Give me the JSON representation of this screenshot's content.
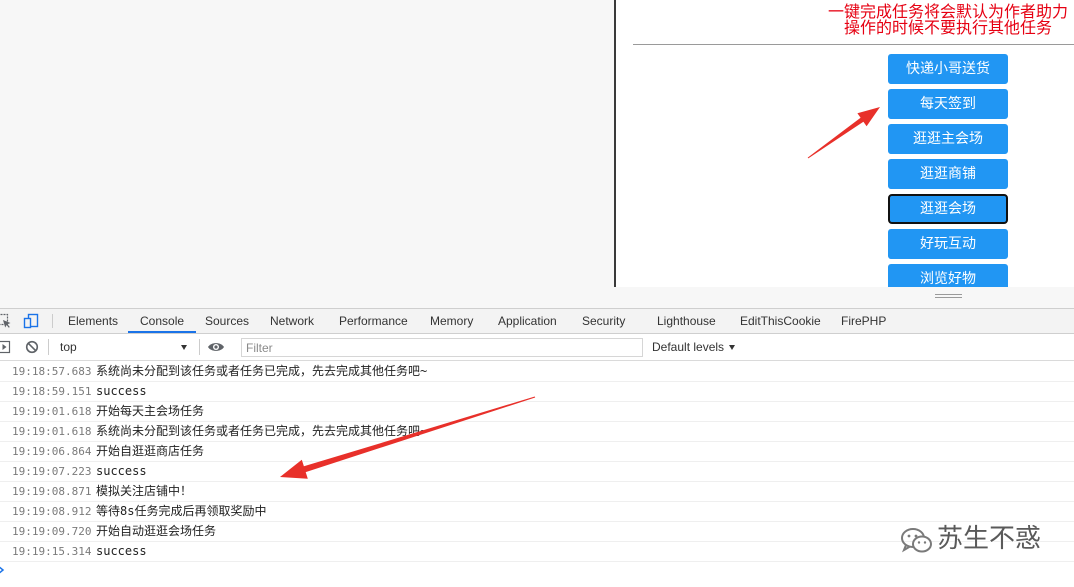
{
  "page": {
    "notice": [
      "一键完成任务将会默认为作者助力",
      "操作的时候不要执行其他任务"
    ],
    "buttons": [
      {
        "label": "快递小哥送货"
      },
      {
        "label": "每天签到"
      },
      {
        "label": "逛逛主会场"
      },
      {
        "label": "逛逛商铺"
      },
      {
        "label": "逛逛会场",
        "focused": true
      },
      {
        "label": "好玩互动"
      },
      {
        "label": "浏览好物"
      }
    ]
  },
  "devtools": {
    "tabs": [
      {
        "label": "Elements"
      },
      {
        "label": "Console",
        "active": true
      },
      {
        "label": "Sources"
      },
      {
        "label": "Network"
      },
      {
        "label": "Performance"
      },
      {
        "label": "Memory"
      },
      {
        "label": "Application"
      },
      {
        "label": "Security"
      },
      {
        "label": "Lighthouse"
      },
      {
        "label": "EditThisCookie"
      },
      {
        "label": "FirePHP"
      }
    ],
    "context": "top",
    "filter_placeholder": "Filter",
    "levels": "Default levels",
    "messages": [
      {
        "time": "19:18:57.683",
        "text": "系统尚未分配到该任务或者任务已完成，先去完成其他任务吧~"
      },
      {
        "time": "19:18:59.151",
        "text": "success"
      },
      {
        "time": "19:19:01.618",
        "text": "开始每天主会场任务"
      },
      {
        "time": "19:19:01.618",
        "text": "系统尚未分配到该任务或者任务已完成，先去完成其他任务吧~"
      },
      {
        "time": "19:19:06.864",
        "text": "开始自逛逛商店任务"
      },
      {
        "time": "19:19:07.223",
        "text": "success"
      },
      {
        "time": "19:19:08.871",
        "text": "模拟关注店铺中！"
      },
      {
        "time": "19:19:08.912",
        "text": "等待8s任务完成后再领取奖励中"
      },
      {
        "time": "19:19:09.720",
        "text": "开始自动逛逛会场任务"
      },
      {
        "time": "19:19:15.314",
        "text": "success"
      }
    ]
  },
  "watermark": {
    "text": "苏生不惑"
  },
  "icons": {
    "inspect": "inspect-element-icon",
    "device": "device-toolbar-icon",
    "sidebar": "sidebar-toggle-icon",
    "clear": "clear-console-icon",
    "eye": "eye-icon",
    "dropdown": "chevron-down-icon",
    "resize": "resize-handle-icon",
    "prompt": "chevron-right-icon",
    "watermark_logo": "wechat-icon"
  },
  "colors": {
    "button": "#2196f3",
    "notice": "#e60012",
    "accent": "#1a73e8",
    "annotation_arrow": "#e8302a"
  }
}
